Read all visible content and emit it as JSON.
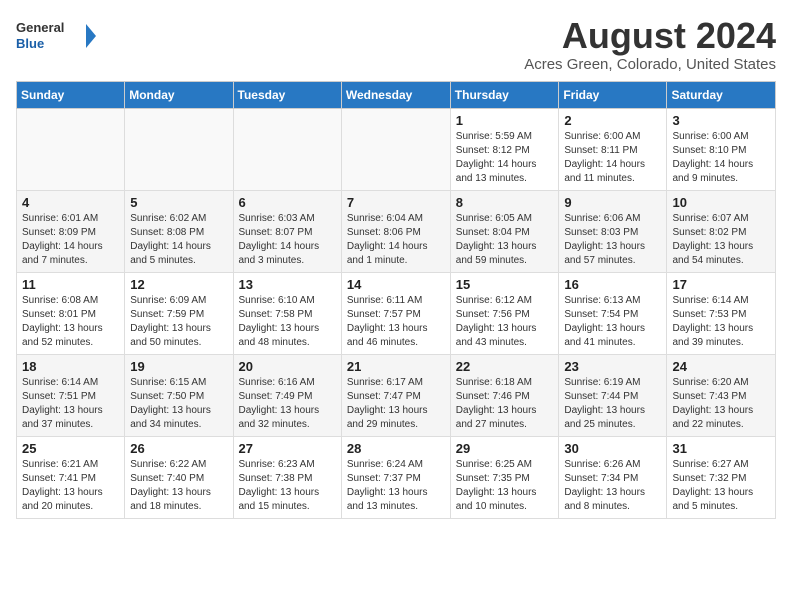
{
  "logo": {
    "general": "General",
    "blue": "Blue"
  },
  "title": "August 2024",
  "subtitle": "Acres Green, Colorado, United States",
  "days_of_week": [
    "Sunday",
    "Monday",
    "Tuesday",
    "Wednesday",
    "Thursday",
    "Friday",
    "Saturday"
  ],
  "weeks": [
    [
      {
        "num": "",
        "info": ""
      },
      {
        "num": "",
        "info": ""
      },
      {
        "num": "",
        "info": ""
      },
      {
        "num": "",
        "info": ""
      },
      {
        "num": "1",
        "info": "Sunrise: 5:59 AM\nSunset: 8:12 PM\nDaylight: 14 hours\nand 13 minutes."
      },
      {
        "num": "2",
        "info": "Sunrise: 6:00 AM\nSunset: 8:11 PM\nDaylight: 14 hours\nand 11 minutes."
      },
      {
        "num": "3",
        "info": "Sunrise: 6:00 AM\nSunset: 8:10 PM\nDaylight: 14 hours\nand 9 minutes."
      }
    ],
    [
      {
        "num": "4",
        "info": "Sunrise: 6:01 AM\nSunset: 8:09 PM\nDaylight: 14 hours\nand 7 minutes."
      },
      {
        "num": "5",
        "info": "Sunrise: 6:02 AM\nSunset: 8:08 PM\nDaylight: 14 hours\nand 5 minutes."
      },
      {
        "num": "6",
        "info": "Sunrise: 6:03 AM\nSunset: 8:07 PM\nDaylight: 14 hours\nand 3 minutes."
      },
      {
        "num": "7",
        "info": "Sunrise: 6:04 AM\nSunset: 8:06 PM\nDaylight: 14 hours\nand 1 minute."
      },
      {
        "num": "8",
        "info": "Sunrise: 6:05 AM\nSunset: 8:04 PM\nDaylight: 13 hours\nand 59 minutes."
      },
      {
        "num": "9",
        "info": "Sunrise: 6:06 AM\nSunset: 8:03 PM\nDaylight: 13 hours\nand 57 minutes."
      },
      {
        "num": "10",
        "info": "Sunrise: 6:07 AM\nSunset: 8:02 PM\nDaylight: 13 hours\nand 54 minutes."
      }
    ],
    [
      {
        "num": "11",
        "info": "Sunrise: 6:08 AM\nSunset: 8:01 PM\nDaylight: 13 hours\nand 52 minutes."
      },
      {
        "num": "12",
        "info": "Sunrise: 6:09 AM\nSunset: 7:59 PM\nDaylight: 13 hours\nand 50 minutes."
      },
      {
        "num": "13",
        "info": "Sunrise: 6:10 AM\nSunset: 7:58 PM\nDaylight: 13 hours\nand 48 minutes."
      },
      {
        "num": "14",
        "info": "Sunrise: 6:11 AM\nSunset: 7:57 PM\nDaylight: 13 hours\nand 46 minutes."
      },
      {
        "num": "15",
        "info": "Sunrise: 6:12 AM\nSunset: 7:56 PM\nDaylight: 13 hours\nand 43 minutes."
      },
      {
        "num": "16",
        "info": "Sunrise: 6:13 AM\nSunset: 7:54 PM\nDaylight: 13 hours\nand 41 minutes."
      },
      {
        "num": "17",
        "info": "Sunrise: 6:14 AM\nSunset: 7:53 PM\nDaylight: 13 hours\nand 39 minutes."
      }
    ],
    [
      {
        "num": "18",
        "info": "Sunrise: 6:14 AM\nSunset: 7:51 PM\nDaylight: 13 hours\nand 37 minutes."
      },
      {
        "num": "19",
        "info": "Sunrise: 6:15 AM\nSunset: 7:50 PM\nDaylight: 13 hours\nand 34 minutes."
      },
      {
        "num": "20",
        "info": "Sunrise: 6:16 AM\nSunset: 7:49 PM\nDaylight: 13 hours\nand 32 minutes."
      },
      {
        "num": "21",
        "info": "Sunrise: 6:17 AM\nSunset: 7:47 PM\nDaylight: 13 hours\nand 29 minutes."
      },
      {
        "num": "22",
        "info": "Sunrise: 6:18 AM\nSunset: 7:46 PM\nDaylight: 13 hours\nand 27 minutes."
      },
      {
        "num": "23",
        "info": "Sunrise: 6:19 AM\nSunset: 7:44 PM\nDaylight: 13 hours\nand 25 minutes."
      },
      {
        "num": "24",
        "info": "Sunrise: 6:20 AM\nSunset: 7:43 PM\nDaylight: 13 hours\nand 22 minutes."
      }
    ],
    [
      {
        "num": "25",
        "info": "Sunrise: 6:21 AM\nSunset: 7:41 PM\nDaylight: 13 hours\nand 20 minutes."
      },
      {
        "num": "26",
        "info": "Sunrise: 6:22 AM\nSunset: 7:40 PM\nDaylight: 13 hours\nand 18 minutes."
      },
      {
        "num": "27",
        "info": "Sunrise: 6:23 AM\nSunset: 7:38 PM\nDaylight: 13 hours\nand 15 minutes."
      },
      {
        "num": "28",
        "info": "Sunrise: 6:24 AM\nSunset: 7:37 PM\nDaylight: 13 hours\nand 13 minutes."
      },
      {
        "num": "29",
        "info": "Sunrise: 6:25 AM\nSunset: 7:35 PM\nDaylight: 13 hours\nand 10 minutes."
      },
      {
        "num": "30",
        "info": "Sunrise: 6:26 AM\nSunset: 7:34 PM\nDaylight: 13 hours\nand 8 minutes."
      },
      {
        "num": "31",
        "info": "Sunrise: 6:27 AM\nSunset: 7:32 PM\nDaylight: 13 hours\nand 5 minutes."
      }
    ]
  ],
  "accent_color": "#2878c3"
}
